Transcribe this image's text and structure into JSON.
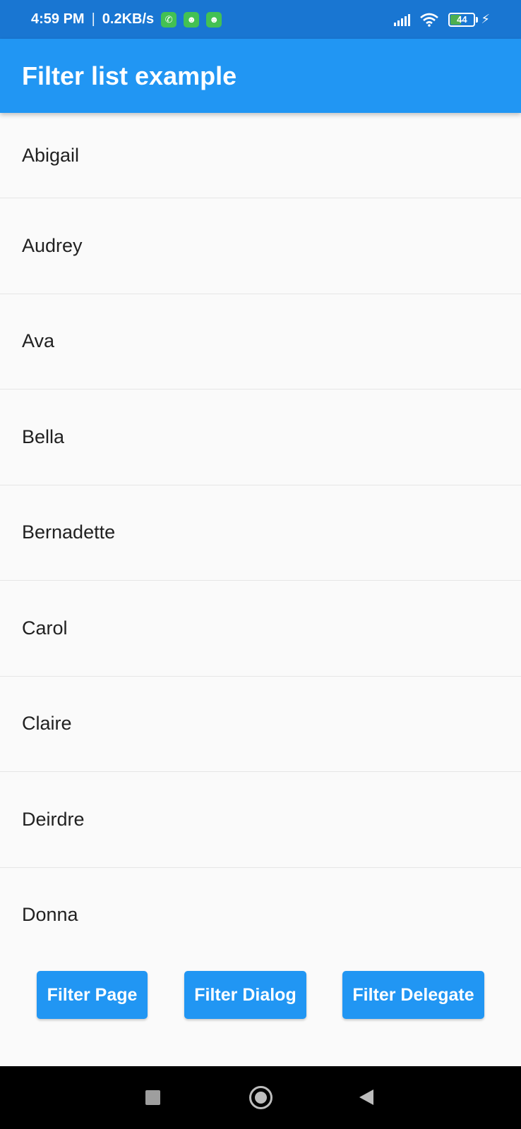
{
  "status_bar": {
    "time": "4:59 PM",
    "separator": "|",
    "speed": "0.2KB/s",
    "battery_level": "44",
    "notifications": [
      "whatsapp-icon",
      "android-icon",
      "android-icon"
    ]
  },
  "app_bar": {
    "title": "Filter list example"
  },
  "list": {
    "items": [
      "Abigail",
      "Audrey",
      "Ava",
      "Bella",
      "Bernadette",
      "Carol",
      "Claire",
      "Deirdre",
      "Donna"
    ]
  },
  "buttons": {
    "filter_page": "Filter Page",
    "filter_dialog": "Filter Dialog",
    "filter_delegate": "Filter Delegate"
  },
  "colors": {
    "app_bar": "#2196f3",
    "status_bar": "#1976d2",
    "button": "#2196f3"
  }
}
